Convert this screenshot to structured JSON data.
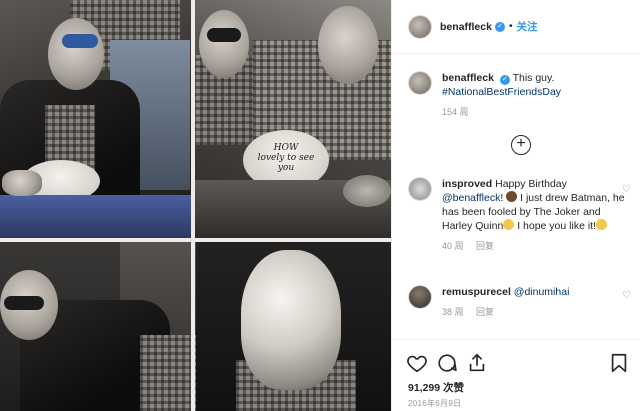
{
  "post": {
    "username": "benaffleck",
    "follow_label": "关注",
    "caption_text": "This guy.",
    "caption_hashtag": "#NationalBestFriendsDay",
    "caption_age": "154 周",
    "likes": "91,299 次赞",
    "date": "2016年6月9日",
    "cake_text": "HOW\nlovely to see\nyou"
  },
  "comments": [
    {
      "username": "insproved",
      "text_1": "Happy Birthday",
      "mention": "@benaffleck",
      "text_2": "! ",
      "text_3": " I just drew Batman, he has been fooled by The Joker and Harley Quinn",
      "text_4": " I hope you like it!",
      "age": "40 周",
      "reply": "回复"
    },
    {
      "username": "remuspurecel",
      "mention": "@dinumihai",
      "age": "38 周",
      "reply": "回复"
    }
  ],
  "icons": {
    "verified": "verified-badge-icon",
    "load_more": "plus-circle-icon",
    "like": "heart-icon",
    "comment": "speech-bubble-icon",
    "share": "share-icon",
    "save": "bookmark-icon"
  },
  "colors": {
    "link": "#003569",
    "accent": "#3897f0",
    "muted": "#999999"
  }
}
